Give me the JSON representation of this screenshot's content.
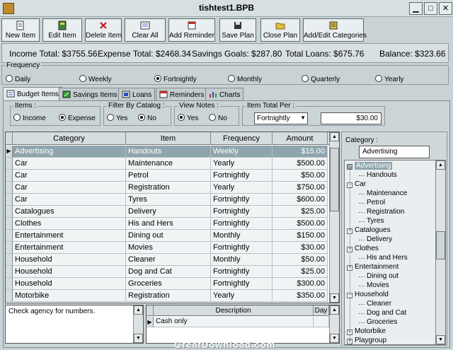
{
  "window": {
    "title": "tishtest1.BPB",
    "controls": [
      "▁",
      "□",
      "✕"
    ]
  },
  "toolbar": [
    {
      "label": "New Item",
      "icon": "new-item-icon"
    },
    {
      "label": "Edit Item",
      "icon": "edit-item-icon"
    },
    {
      "label": "Delete Item",
      "icon": "delete-item-icon"
    },
    {
      "label": "Clear All",
      "icon": "clear-all-icon"
    },
    {
      "label": "Add Reminder",
      "icon": "add-reminder-icon"
    },
    {
      "label": "Save Plan",
      "icon": "save-plan-icon"
    },
    {
      "label": "Close Plan",
      "icon": "close-plan-icon"
    },
    {
      "label": "Add/Edit Categories",
      "icon": "categories-icon"
    }
  ],
  "totals": {
    "income": "Income Total: $3755.56",
    "expense": "Expense Total: $2468.34",
    "savings": "Savings Goals: $287.80",
    "loans": "Total Loans: $675.76",
    "balance": "Balance: $323.66"
  },
  "frequency": {
    "title": "Frequency",
    "options": [
      "Daily",
      "Weekly",
      "Fortnightly",
      "Monthly",
      "Quarterly",
      "Yearly"
    ],
    "selected": "Fortnightly"
  },
  "tabs": [
    {
      "label": "Budget Items",
      "active": true
    },
    {
      "label": "Savings Items",
      "active": false
    },
    {
      "label": "Loans",
      "active": false
    },
    {
      "label": "Reminders",
      "active": false
    },
    {
      "label": "Charts",
      "active": false
    }
  ],
  "filters": {
    "items": {
      "title": "Items :",
      "opt1": "Income",
      "opt2": "Expense",
      "selected": "Expense"
    },
    "catalog": {
      "title": "Filter By Catalog :",
      "opt1": "Yes",
      "opt2": "No",
      "selected": "No"
    },
    "notes": {
      "title": "View Notes :",
      "opt1": "Yes",
      "opt2": "No",
      "selected": "Yes"
    },
    "total_per": {
      "title": "Item Total Per :",
      "value": "Fortnightly",
      "amount": "$30.00"
    }
  },
  "grid": {
    "columns": [
      "Category",
      "Item",
      "Frequency",
      "Amount"
    ],
    "rows": [
      [
        "Advertising",
        "Handouts",
        "Weekly",
        "$15.00"
      ],
      [
        "Car",
        "Maintenance",
        "Yearly",
        "$500.00"
      ],
      [
        "Car",
        "Petrol",
        "Fortnightly",
        "$50.00"
      ],
      [
        "Car",
        "Registration",
        "Yearly",
        "$750.00"
      ],
      [
        "Car",
        "Tyres",
        "Fortnightly",
        "$600.00"
      ],
      [
        "Catalogues",
        "Delivery",
        "Fortnightly",
        "$25.00"
      ],
      [
        "Clothes",
        "His and Hers",
        "Fortnightly",
        "$500.00"
      ],
      [
        "Entertainment",
        "Dining out",
        "Monthly",
        "$150.00"
      ],
      [
        "Entertainment",
        "Movies",
        "Fortnightly",
        "$30.00"
      ],
      [
        "Household",
        "Cleaner",
        "Monthly",
        "$50.00"
      ],
      [
        "Household",
        "Dog and Cat",
        "Fortnightly",
        "$25.00"
      ],
      [
        "Household",
        "Groceries",
        "Fortnightly",
        "$300.00"
      ],
      [
        "Motorbike",
        "Registration",
        "Yearly",
        "$350.00"
      ]
    ]
  },
  "notes": {
    "text": "Check agency for numbers."
  },
  "desc_grid": {
    "columns": [
      "Description",
      "Day"
    ],
    "rows": [
      [
        "Cash only",
        ""
      ]
    ]
  },
  "side": {
    "category_label": "Category :",
    "category_value": "Advertising"
  },
  "tree": [
    {
      "label": "Advertising",
      "level": 0,
      "selected": true
    },
    {
      "label": "Handouts",
      "level": 1
    },
    {
      "label": "Car",
      "level": 0
    },
    {
      "label": "Maintenance",
      "level": 1
    },
    {
      "label": "Petrol",
      "level": 1
    },
    {
      "label": "Registration",
      "level": 1
    },
    {
      "label": "Tyres",
      "level": 1
    },
    {
      "label": "Catalogues",
      "level": 0
    },
    {
      "label": "Delivery",
      "level": 1
    },
    {
      "label": "Clothes",
      "level": 0
    },
    {
      "label": "His and Hers",
      "level": 1
    },
    {
      "label": "Entertainment",
      "level": 0
    },
    {
      "label": "Dining out",
      "level": 1
    },
    {
      "label": "Movies",
      "level": 1
    },
    {
      "label": "Household",
      "level": 0
    },
    {
      "label": "Cleaner",
      "level": 1
    },
    {
      "label": "Dog and Cat",
      "level": 1
    },
    {
      "label": "Groceries",
      "level": 1
    },
    {
      "label": "Motorbike",
      "level": 0,
      "collapsed": true
    },
    {
      "label": "Playgroup",
      "level": 0,
      "collapsed": true
    }
  ],
  "watermark": "GreatDownload.com",
  "colors": {
    "selection": "#8fa5ad",
    "window": "#c9d3d6"
  }
}
